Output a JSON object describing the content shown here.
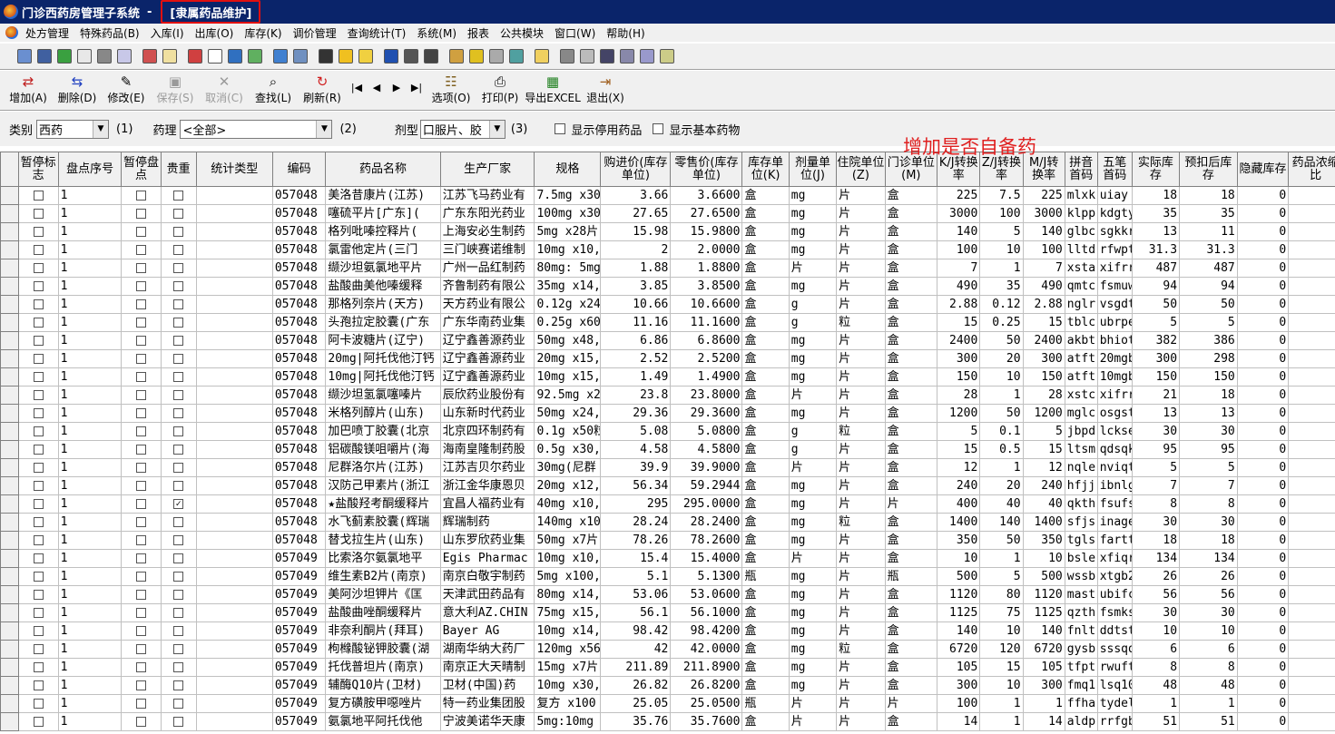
{
  "window": {
    "title": "门诊西药房管理子系统",
    "subtitle": "[隶属药品维护]"
  },
  "menu": [
    "处方管理",
    "特殊药品(B)",
    "入库(I)",
    "出库(O)",
    "库存(K)",
    "调价管理",
    "查询统计(T)",
    "系统(M)",
    "报表",
    "公共模块",
    "窗口(W)",
    "帮助(H)"
  ],
  "toolbar": {
    "add": "增加(A)",
    "delete": "删除(D)",
    "modify": "修改(E)",
    "save": "保存(S)",
    "cancel": "取消(C)",
    "find": "查找(L)",
    "refresh": "刷新(R)",
    "options": "选项(O)",
    "print": "打印(P)",
    "export": "导出EXCEL",
    "exit": "退出(X)"
  },
  "filters": {
    "category_label": "类别",
    "category_value": "西药",
    "category_num": "(1)",
    "pharm_label": "药理",
    "pharm_value": "<全部>",
    "pharm_num": "(2)",
    "form_label": "剂型",
    "form_value": "口服片、胶",
    "form_num": "(3)",
    "show_disabled": "显示停用药品",
    "show_basic": "显示基本药物"
  },
  "annotation": "增加是否自备药",
  "columns": [
    "暂停标志",
    "盘点序号",
    "暂停盘点",
    "贵重",
    "统计类型",
    "编码",
    "药品名称",
    "生产厂家",
    "规格",
    "购进价(库存单位)",
    "零售价(库存单位)",
    "库存单位(K)",
    "剂量单位(J)",
    "住院单位(Z)",
    "门诊单位(M)",
    "K/J转换率",
    "Z/J转换率",
    "M/J转换率",
    "拼音首码",
    "五笔首码",
    "实际库存",
    "预扣后库存",
    "隐藏库存",
    "药品浓缩比"
  ],
  "rows": [
    {
      "idx": "1",
      "code": "057048",
      "name": "美洛昔康片(江苏)",
      "mfr": "江苏飞马药业有",
      "spec": "7.5mg x30",
      "buy": "3.66",
      "retail": "3.6600",
      "ku": "盒",
      "ju": "mg",
      "zu": "片",
      "mu": "盒",
      "kj": "225",
      "zj": "7.5",
      "mj": "225",
      "py": "mlxk",
      "wb": "uiay",
      "stock": "18",
      "after": "18",
      "hidden": "0",
      "valuable": false
    },
    {
      "idx": "1",
      "code": "057048",
      "name": "噻硫平片[广东](",
      "mfr": "广东东阳光药业",
      "spec": "100mg x30",
      "buy": "27.65",
      "retail": "27.6500",
      "ku": "盒",
      "ju": "mg",
      "zu": "片",
      "mu": "盒",
      "kj": "3000",
      "zj": "100",
      "mj": "3000",
      "py": "klpp",
      "wb": "kdgty",
      "stock": "35",
      "after": "35",
      "hidden": "0",
      "valuable": false
    },
    {
      "idx": "1",
      "code": "057048",
      "name": "格列吡嗪控释片(",
      "mfr": "上海安必生制药",
      "spec": "5mg x28片",
      "buy": "15.98",
      "retail": "15.9800",
      "ku": "盒",
      "ju": "mg",
      "zu": "片",
      "mu": "盒",
      "kj": "140",
      "zj": "5",
      "mj": "140",
      "py": "glbc",
      "wb": "sgkkr",
      "stock": "13",
      "after": "11",
      "hidden": "0",
      "valuable": false
    },
    {
      "idx": "1",
      "code": "057048",
      "name": "氯雷他定片(三门",
      "mfr": "三门峡赛诺维制",
      "spec": "10mg x10,",
      "buy": "2",
      "retail": "2.0000",
      "ku": "盒",
      "ju": "mg",
      "zu": "片",
      "mu": "盒",
      "kj": "100",
      "zj": "10",
      "mj": "100",
      "py": "lltd",
      "wb": "rfwpt",
      "stock": "31.3",
      "after": "31.3",
      "hidden": "0",
      "valuable": false
    },
    {
      "idx": "1",
      "code": "057048",
      "name": "缬沙坦氨氯地平片",
      "mfr": "广州一品红制药",
      "spec": "80mg: 5mg",
      "buy": "1.88",
      "retail": "1.8800",
      "ku": "盒",
      "ju": "片",
      "zu": "片",
      "mu": "盒",
      "kj": "7",
      "zj": "1",
      "mj": "7",
      "py": "xsta",
      "wb": "xifrr",
      "stock": "487",
      "after": "487",
      "hidden": "0",
      "valuable": false
    },
    {
      "idx": "1",
      "code": "057048",
      "name": "盐酸曲美他嗪缓释",
      "mfr": "齐鲁制药有限公",
      "spec": "35mg x14,",
      "buy": "3.85",
      "retail": "3.8500",
      "ku": "盒",
      "ju": "mg",
      "zu": "片",
      "mu": "盒",
      "kj": "490",
      "zj": "35",
      "mj": "490",
      "py": "qmtc",
      "wb": "fsmuw",
      "stock": "94",
      "after": "94",
      "hidden": "0",
      "valuable": false
    },
    {
      "idx": "1",
      "code": "057048",
      "name": "那格列奈片(天方)",
      "mfr": "天方药业有限公",
      "spec": "0.12g x24",
      "buy": "10.66",
      "retail": "10.6600",
      "ku": "盒",
      "ju": "g",
      "zu": "片",
      "mu": "盒",
      "kj": "2.88",
      "zj": "0.12",
      "mj": "2.88",
      "py": "nglr",
      "wb": "vsgdt",
      "stock": "50",
      "after": "50",
      "hidden": "0",
      "valuable": false
    },
    {
      "idx": "1",
      "code": "057048",
      "name": "头孢拉定胶囊(广东",
      "mfr": "广东华南药业集",
      "spec": "0.25g x60",
      "buy": "11.16",
      "retail": "11.1600",
      "ku": "盒",
      "ju": "g",
      "zu": "粒",
      "mu": "盒",
      "kj": "15",
      "zj": "0.25",
      "mj": "15",
      "py": "tblc",
      "wb": "ubrpe",
      "stock": "5",
      "after": "5",
      "hidden": "0",
      "valuable": false
    },
    {
      "idx": "1",
      "code": "057048",
      "name": "阿卡波糖片(辽宁)",
      "mfr": "辽宁鑫善源药业",
      "spec": "50mg x48,",
      "buy": "6.86",
      "retail": "6.8600",
      "ku": "盒",
      "ju": "mg",
      "zu": "片",
      "mu": "盒",
      "kj": "2400",
      "zj": "50",
      "mj": "2400",
      "py": "akbt",
      "wb": "bhiot",
      "stock": "382",
      "after": "386",
      "hidden": "0",
      "valuable": false
    },
    {
      "idx": "1",
      "code": "057048",
      "name": "20mg|阿托伐他汀钙",
      "mfr": "辽宁鑫善源药业",
      "spec": "20mg x15,",
      "buy": "2.52",
      "retail": "2.5200",
      "ku": "盒",
      "ju": "mg",
      "zu": "片",
      "mu": "盒",
      "kj": "300",
      "zj": "20",
      "mj": "300",
      "py": "atft",
      "wb": "20mgb",
      "stock": "300",
      "after": "298",
      "hidden": "0",
      "valuable": false
    },
    {
      "idx": "1",
      "code": "057048",
      "name": "10mg|阿托伐他汀钙",
      "mfr": "辽宁鑫善源药业",
      "spec": "10mg x15,",
      "buy": "1.49",
      "retail": "1.4900",
      "ku": "盒",
      "ju": "mg",
      "zu": "片",
      "mu": "盒",
      "kj": "150",
      "zj": "10",
      "mj": "150",
      "py": "atft",
      "wb": "10mgb",
      "stock": "150",
      "after": "150",
      "hidden": "0",
      "valuable": false
    },
    {
      "idx": "1",
      "code": "057048",
      "name": "缬沙坦氢氯噻嗪片",
      "mfr": "辰欣药业股份有",
      "spec": "92.5mg x2",
      "buy": "23.8",
      "retail": "23.8000",
      "ku": "盒",
      "ju": "片",
      "zu": "片",
      "mu": "盒",
      "kj": "28",
      "zj": "1",
      "mj": "28",
      "py": "xstc",
      "wb": "xifrr",
      "stock": "21",
      "after": "18",
      "hidden": "0",
      "valuable": false
    },
    {
      "idx": "1",
      "code": "057048",
      "name": "米格列醇片(山东)",
      "mfr": "山东新时代药业",
      "spec": "50mg x24,",
      "buy": "29.36",
      "retail": "29.3600",
      "ku": "盒",
      "ju": "mg",
      "zu": "片",
      "mu": "盒",
      "kj": "1200",
      "zj": "50",
      "mj": "1200",
      "py": "mglc",
      "wb": "osgst",
      "stock": "13",
      "after": "13",
      "hidden": "0",
      "valuable": false
    },
    {
      "idx": "1",
      "code": "057048",
      "name": "加巴喷丁胶囊(北京",
      "mfr": "北京四环制药有",
      "spec": "0.1g x50粒",
      "buy": "5.08",
      "retail": "5.0800",
      "ku": "盒",
      "ju": "g",
      "zu": "粒",
      "mu": "盒",
      "kj": "5",
      "zj": "0.1",
      "mj": "5",
      "py": "jbpd",
      "wb": "lckse",
      "stock": "30",
      "after": "30",
      "hidden": "0",
      "valuable": false
    },
    {
      "idx": "1",
      "code": "057048",
      "name": "铝碳酸镁咀嚼片(海",
      "mfr": "海南皇隆制药股",
      "spec": "0.5g x30,",
      "buy": "4.58",
      "retail": "4.5800",
      "ku": "盒",
      "ju": "g",
      "zu": "片",
      "mu": "盒",
      "kj": "15",
      "zj": "0.5",
      "mj": "15",
      "py": "ltsm",
      "wb": "qdsqk",
      "stock": "95",
      "after": "95",
      "hidden": "0",
      "valuable": false
    },
    {
      "idx": "1",
      "code": "057048",
      "name": "尼群洛尔片(江苏)",
      "mfr": "江苏吉贝尔药业",
      "spec": "30mg(尼群",
      "buy": "39.9",
      "retail": "39.9000",
      "ku": "盒",
      "ju": "片",
      "zu": "片",
      "mu": "盒",
      "kj": "12",
      "zj": "1",
      "mj": "12",
      "py": "nqle",
      "wb": "nviqt",
      "stock": "5",
      "after": "5",
      "hidden": "0",
      "valuable": false
    },
    {
      "idx": "1",
      "code": "057048",
      "name": "汉防己甲素片(浙江",
      "mfr": "浙江金华康恩贝",
      "spec": "20mg x12,",
      "buy": "56.34",
      "retail": "59.2944",
      "ku": "盒",
      "ju": "mg",
      "zu": "片",
      "mu": "盒",
      "kj": "240",
      "zj": "20",
      "mj": "240",
      "py": "hfjj",
      "wb": "ibnlg",
      "stock": "7",
      "after": "7",
      "hidden": "0",
      "valuable": false
    },
    {
      "idx": "1",
      "code": "057048",
      "name": "★盐酸羟考酮缓释片",
      "mfr": "宜昌人福药业有",
      "spec": "40mg x10,",
      "buy": "295",
      "retail": "295.0000",
      "ku": "盒",
      "ju": "mg",
      "zu": "片",
      "mu": "片",
      "kj": "400",
      "zj": "40",
      "mj": "40",
      "py": "qkth",
      "wb": "fsufs",
      "stock": "8",
      "after": "8",
      "hidden": "0",
      "valuable": true
    },
    {
      "idx": "1",
      "code": "057048",
      "name": "水飞蓟素胶囊(辉瑞",
      "mfr": "辉瑞制药",
      "spec": "140mg x10",
      "buy": "28.24",
      "retail": "28.2400",
      "ku": "盒",
      "ju": "mg",
      "zu": "粒",
      "mu": "盒",
      "kj": "1400",
      "zj": "140",
      "mj": "1400",
      "py": "sfjs",
      "wb": "inage",
      "stock": "30",
      "after": "30",
      "hidden": "0",
      "valuable": false
    },
    {
      "idx": "1",
      "code": "057048",
      "name": "替戈拉生片(山东)",
      "mfr": "山东罗欣药业集",
      "spec": "50mg x7片",
      "buy": "78.26",
      "retail": "78.2600",
      "ku": "盒",
      "ju": "mg",
      "zu": "片",
      "mu": "盒",
      "kj": "350",
      "zj": "50",
      "mj": "350",
      "py": "tgls",
      "wb": "fartt",
      "stock": "18",
      "after": "18",
      "hidden": "0",
      "valuable": false
    },
    {
      "idx": "1",
      "code": "057049",
      "name": "比索洛尔氨氯地平",
      "mfr": "Egis Pharmac",
      "spec": "10mg x10,",
      "buy": "15.4",
      "retail": "15.4000",
      "ku": "盒",
      "ju": "片",
      "zu": "片",
      "mu": "盒",
      "kj": "10",
      "zj": "1",
      "mj": "10",
      "py": "bsle",
      "wb": "xfiqr",
      "stock": "134",
      "after": "134",
      "hidden": "0",
      "valuable": false
    },
    {
      "idx": "1",
      "code": "057049",
      "name": "维生素B2片(南京)",
      "mfr": "南京白敬宇制药",
      "spec": "5mg x100,",
      "buy": "5.1",
      "retail": "5.1300",
      "ku": "瓶",
      "ju": "mg",
      "zu": "片",
      "mu": "瓶",
      "kj": "500",
      "zj": "5",
      "mj": "500",
      "py": "wssb",
      "wb": "xtgb2",
      "stock": "26",
      "after": "26",
      "hidden": "0",
      "valuable": false
    },
    {
      "idx": "1",
      "code": "057049",
      "name": "美阿沙坦钾片《匡",
      "mfr": "天津武田药品有",
      "spec": "80mg x14,",
      "buy": "53.06",
      "retail": "53.0600",
      "ku": "盒",
      "ju": "mg",
      "zu": "片",
      "mu": "盒",
      "kj": "1120",
      "zj": "80",
      "mj": "1120",
      "py": "mast",
      "wb": "ubifc",
      "stock": "56",
      "after": "56",
      "hidden": "0",
      "valuable": false
    },
    {
      "idx": "1",
      "code": "057049",
      "name": "盐酸曲唑酮缓释片",
      "mfr": "意大利AZ.CHIN",
      "spec": "75mg x15,",
      "buy": "56.1",
      "retail": "56.1000",
      "ku": "盒",
      "ju": "mg",
      "zu": "片",
      "mu": "盒",
      "kj": "1125",
      "zj": "75",
      "mj": "1125",
      "py": "qzth",
      "wb": "fsmks",
      "stock": "30",
      "after": "30",
      "hidden": "0",
      "valuable": false
    },
    {
      "idx": "1",
      "code": "057049",
      "name": "非奈利酮片(拜耳)",
      "mfr": "Bayer AG",
      "spec": "10mg x14,",
      "buy": "98.42",
      "retail": "98.4200",
      "ku": "盒",
      "ju": "mg",
      "zu": "片",
      "mu": "盒",
      "kj": "140",
      "zj": "10",
      "mj": "140",
      "py": "fnlt",
      "wb": "ddtst",
      "stock": "10",
      "after": "10",
      "hidden": "0",
      "valuable": false
    },
    {
      "idx": "1",
      "code": "057049",
      "name": "枸橼酸铋钾胶囊(湖",
      "mfr": "湖南华纳大药厂",
      "spec": "120mg x56",
      "buy": "42",
      "retail": "42.0000",
      "ku": "盒",
      "ju": "mg",
      "zu": "粒",
      "mu": "盒",
      "kj": "6720",
      "zj": "120",
      "mj": "6720",
      "py": "gysb",
      "wb": "sssqq",
      "stock": "6",
      "after": "6",
      "hidden": "0",
      "valuable": false
    },
    {
      "idx": "1",
      "code": "057049",
      "name": "托伐普坦片(南京)",
      "mfr": "南京正大天晴制",
      "spec": "15mg x7片",
      "buy": "211.89",
      "retail": "211.8900",
      "ku": "盒",
      "ju": "mg",
      "zu": "片",
      "mu": "盒",
      "kj": "105",
      "zj": "15",
      "mj": "105",
      "py": "tfpt",
      "wb": "rwuft",
      "stock": "8",
      "after": "8",
      "hidden": "0",
      "valuable": false
    },
    {
      "idx": "1",
      "code": "057049",
      "name": "辅酶Q10片(卫材)",
      "mfr": "卫材(中国)药",
      "spec": "10mg x30,",
      "buy": "26.82",
      "retail": "26.8200",
      "ku": "盒",
      "ju": "mg",
      "zu": "片",
      "mu": "盒",
      "kj": "300",
      "zj": "10",
      "mj": "300",
      "py": "fmq1",
      "wb": "lsq10",
      "stock": "48",
      "after": "48",
      "hidden": "0",
      "valuable": false
    },
    {
      "idx": "1",
      "code": "057049",
      "name": "复方磺胺甲噁唑片",
      "mfr": "特一药业集团股",
      "spec": "复方 x100",
      "buy": "25.05",
      "retail": "25.0500",
      "ku": "瓶",
      "ju": "片",
      "zu": "片",
      "mu": "片",
      "kj": "100",
      "zj": "1",
      "mj": "1",
      "py": "ffha",
      "wb": "tydel",
      "stock": "1",
      "after": "1",
      "hidden": "0",
      "valuable": false
    },
    {
      "idx": "1",
      "code": "057049",
      "name": "氨氯地平阿托伐他",
      "mfr": "宁波美诺华天康",
      "spec": "5mg:10mg",
      "buy": "35.76",
      "retail": "35.7600",
      "ku": "盒",
      "ju": "片",
      "zu": "片",
      "mu": "盒",
      "kj": "14",
      "zj": "1",
      "mj": "14",
      "py": "aldp",
      "wb": "rrfgb",
      "stock": "51",
      "after": "51",
      "hidden": "0",
      "valuable": false
    }
  ]
}
